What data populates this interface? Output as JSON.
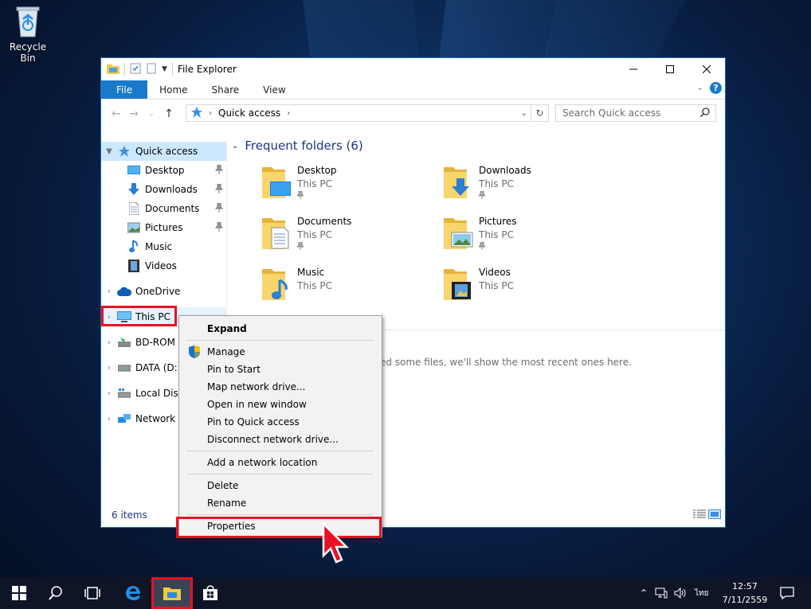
{
  "desktop": {
    "recycle_bin_label": "Recycle Bin"
  },
  "window": {
    "title": "File Explorer",
    "ribbon_tabs": [
      "File",
      "Home",
      "Share",
      "View"
    ],
    "address_crumb": "Quick access",
    "search_placeholder": "Search Quick access",
    "status_items": "6 items"
  },
  "nav_pane": {
    "items": [
      {
        "label": "Quick access",
        "icon": "star-icon",
        "pinned": false
      },
      {
        "label": "Desktop",
        "icon": "desktop-icon",
        "pinned": true
      },
      {
        "label": "Downloads",
        "icon": "download-icon",
        "pinned": true
      },
      {
        "label": "Documents",
        "icon": "document-icon",
        "pinned": true
      },
      {
        "label": "Pictures",
        "icon": "pictures-icon",
        "pinned": true
      },
      {
        "label": "Music",
        "icon": "music-icon",
        "pinned": false
      },
      {
        "label": "Videos",
        "icon": "videos-icon",
        "pinned": false
      },
      {
        "label": "OneDrive",
        "icon": "cloud-icon",
        "pinned": false
      },
      {
        "label": "This PC",
        "icon": "computer-icon",
        "pinned": false
      },
      {
        "label": "BD-ROM D",
        "icon": "disc-icon",
        "pinned": false
      },
      {
        "label": "DATA (D:)",
        "icon": "drive-icon",
        "pinned": false
      },
      {
        "label": "Local Disk",
        "icon": "local-disk-icon",
        "pinned": false
      },
      {
        "label": "Network",
        "icon": "network-icon",
        "pinned": false
      }
    ]
  },
  "content": {
    "group_title": "Frequent folders (6)",
    "folders": [
      {
        "name": "Desktop",
        "location": "This PC"
      },
      {
        "name": "Downloads",
        "location": "This PC"
      },
      {
        "name": "Documents",
        "location": "This PC"
      },
      {
        "name": "Pictures",
        "location": "This PC"
      },
      {
        "name": "Music",
        "location": "This PC"
      },
      {
        "name": "Videos",
        "location": "This PC"
      }
    ],
    "recent_message": "opened some files, we'll show the most recent ones here."
  },
  "context_menu": {
    "items": [
      "Expand",
      "Manage",
      "Pin to Start",
      "Map network drive...",
      "Open in new window",
      "Pin to Quick access",
      "Disconnect network drive...",
      "Add a network location",
      "Delete",
      "Rename",
      "Properties"
    ]
  },
  "taskbar": {
    "time": "12:57",
    "date": "7/11/2559",
    "language": "ไทย"
  },
  "colors": {
    "accent": "#1979ca",
    "highlight_red": "#e81123",
    "selection": "#cce8ff",
    "folder_yellow": "#f5c842"
  }
}
